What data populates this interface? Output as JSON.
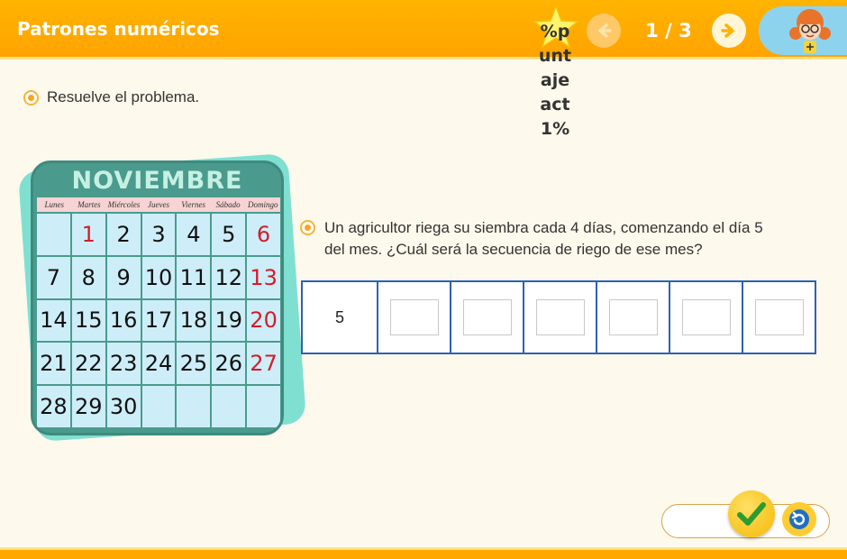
{
  "header": {
    "title": "Patrones numéricos",
    "star_score": "%puntaje act1%",
    "page_counter": "1 / 3"
  },
  "instruction": "Resuelve el problema.",
  "calendar": {
    "month": "NOVIEMBRE",
    "weekdays": [
      "Lunes",
      "Martes",
      "Miércoles",
      "Jueves",
      "Viernes",
      "Sábado",
      "Domingo"
    ],
    "cells": [
      "",
      "1",
      "2",
      "3",
      "4",
      "5",
      "6",
      "7",
      "8",
      "9",
      "10",
      "11",
      "12",
      "13",
      "14",
      "15",
      "16",
      "17",
      "18",
      "19",
      "20",
      "21",
      "22",
      "23",
      "24",
      "25",
      "26",
      "27",
      "28",
      "29",
      "30",
      "",
      "",
      "",
      ""
    ],
    "red_days": [
      "1",
      "6",
      "13",
      "20",
      "27"
    ]
  },
  "question": {
    "text": "Un agricultor riega su siembra cada 4 días, comenzando el día 5 del mes. ¿Cuál será la secuencia de riego de ese mes?",
    "given_value": "5",
    "blank_count": 6
  },
  "colors": {
    "header": "#ffa300",
    "accent_blue": "#2e61b4",
    "check_green": "#2e9b2e",
    "calendar_red": "#d41c2a"
  },
  "icons": {
    "prev": "arrow-left-icon",
    "next": "arrow-right-icon",
    "star": "star-icon",
    "check": "check-icon",
    "reset": "reset-icon",
    "avatar": "avatar-girl"
  }
}
